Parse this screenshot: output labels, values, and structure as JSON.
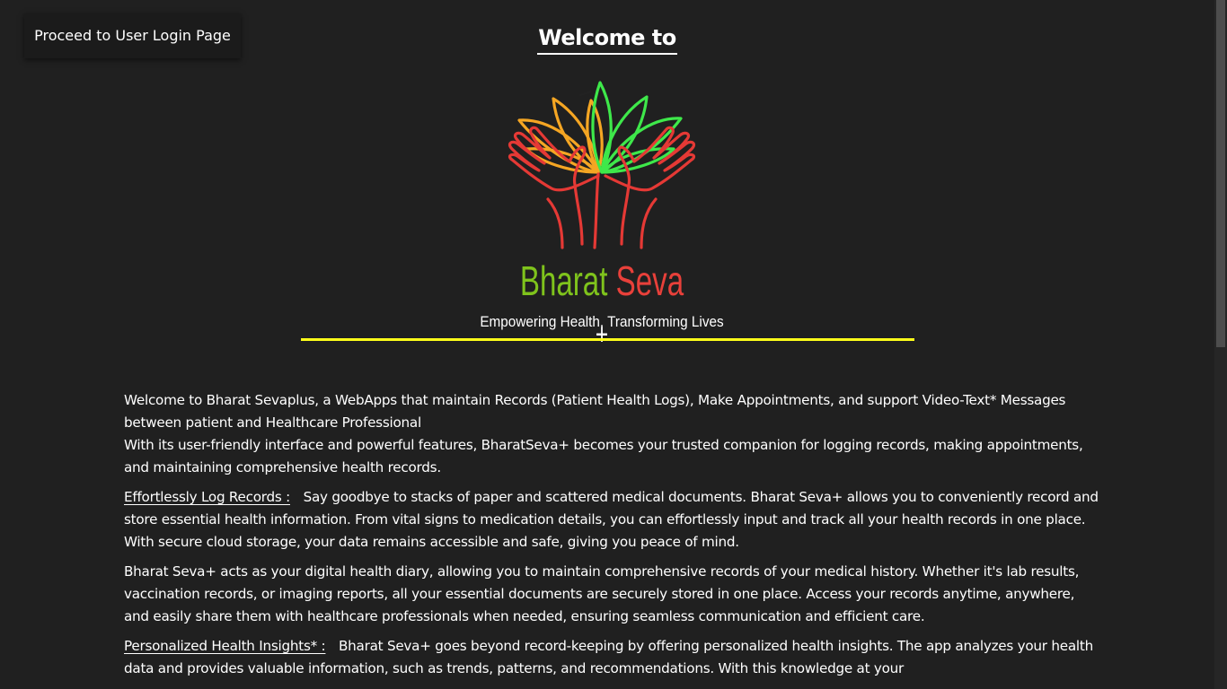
{
  "header": {
    "login_button_label": "Proceed to User Login Page",
    "welcome_title": "Welcome to"
  },
  "brand": {
    "name_part1": "Bharat",
    "name_part2": "Seva",
    "name_part3": "+",
    "tagline": "Empowering Health, Transforming Lives",
    "colors": {
      "lotus_orange": "#f5a623",
      "lotus_green": "#3ee84a",
      "hands_red": "#e53935",
      "name_green": "#7fc31c",
      "name_red": "#e8403a",
      "rule_yellow": "#ffff1a"
    }
  },
  "content": {
    "intro_line1": "Welcome to Bharat Sevaplus, a WebApps that maintain Records (Patient Health Logs), Make Appointments, and support Video-Text* Messages between patient and Healthcare Professional",
    "intro_line2": "With its user-friendly interface and powerful features, BharatSeva+ becomes your trusted companion for logging records, making appointments, and maintaining comprehensive health records.",
    "section1_heading": "Effortlessly Log Records :",
    "section1_text": "Say goodbye to stacks of paper and scattered medical documents. Bharat Seva+ allows you to conveniently record and store essential health information. From vital signs to medication details, you can effortlessly input and track all your health records in one place. With secure cloud storage, your data remains accessible and safe, giving you peace of mind.",
    "section2_text": "Bharat Seva+ acts as your digital health diary, allowing you to maintain comprehensive records of your medical history. Whether it's lab results, vaccination records, or imaging reports, all your essential documents are securely stored in one place. Access your records anytime, anywhere, and easily share them with healthcare professionals when needed, ensuring seamless communication and efficient care.",
    "section3_heading": "Personalized Health Insights* :",
    "section3_text": "Bharat Seva+ goes beyond record-keeping by offering personalized health insights. The app analyzes your health data and provides valuable information, such as trends, patterns, and recommendations. With this knowledge at your"
  }
}
